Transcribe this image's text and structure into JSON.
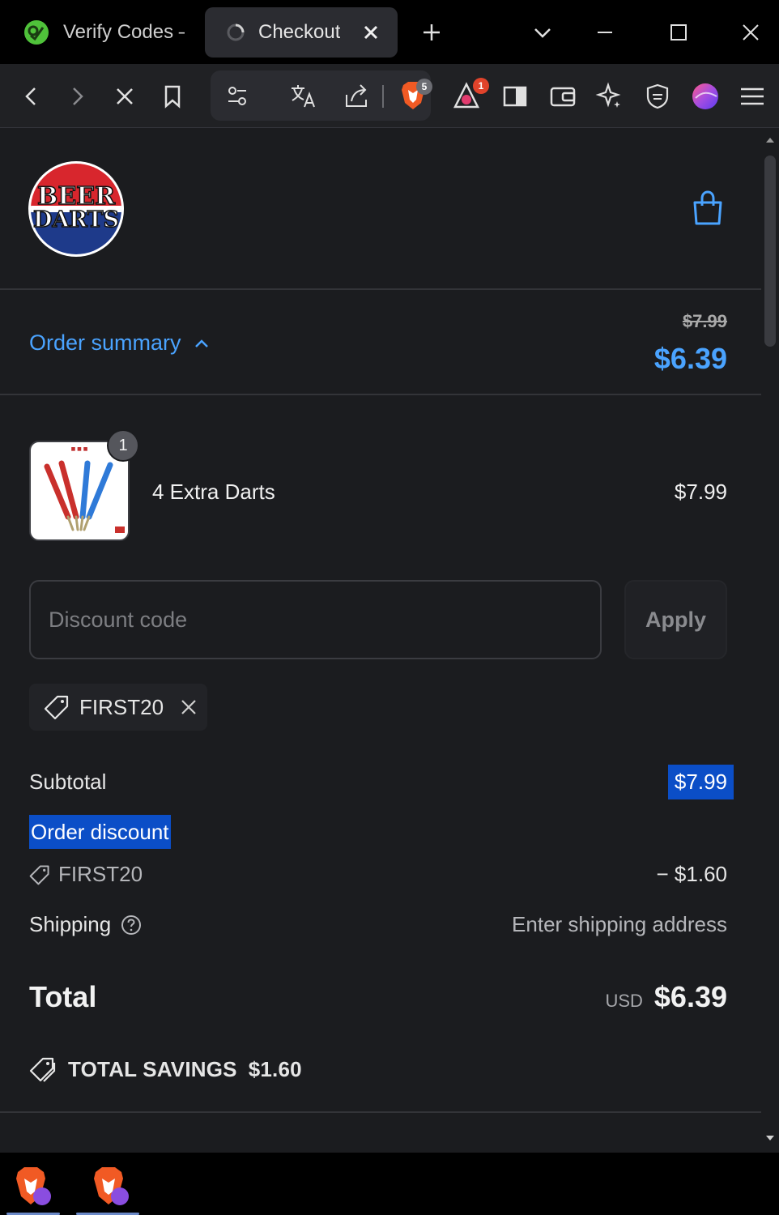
{
  "browser": {
    "tabs": [
      {
        "title": "Verify Codes –",
        "active": false,
        "icon": "verify-codes-favicon"
      },
      {
        "title": "Checkout",
        "active": true,
        "icon": "loading-favicon"
      }
    ],
    "badges": {
      "brave_shields": "5",
      "brave_rewards": "1"
    }
  },
  "store": {
    "logo_text": "BEER DARTS",
    "cart_icon": "shopping-bag-icon"
  },
  "summary": {
    "toggle_label": "Order summary",
    "original_price": "$7.99",
    "discounted_price": "$6.39"
  },
  "item": {
    "name": "4 Extra Darts",
    "price": "$7.99",
    "quantity": "1"
  },
  "discount": {
    "placeholder": "Discount code",
    "apply_label": "Apply",
    "applied_code": "FIRST20"
  },
  "totals": {
    "subtotal_label": "Subtotal",
    "subtotal_value": "$7.99",
    "order_discount_label": "Order discount",
    "discount_code": "FIRST20",
    "discount_value": "− $1.60",
    "shipping_label": "Shipping",
    "shipping_value": "Enter shipping address",
    "total_label": "Total",
    "currency": "USD",
    "total_value": "$6.39",
    "savings_label": "TOTAL SAVINGS",
    "savings_value": "$1.60"
  },
  "colors": {
    "accent": "#4aa3ff",
    "selection": "#0b4ec7",
    "page_bg": "#1b1c1f"
  }
}
